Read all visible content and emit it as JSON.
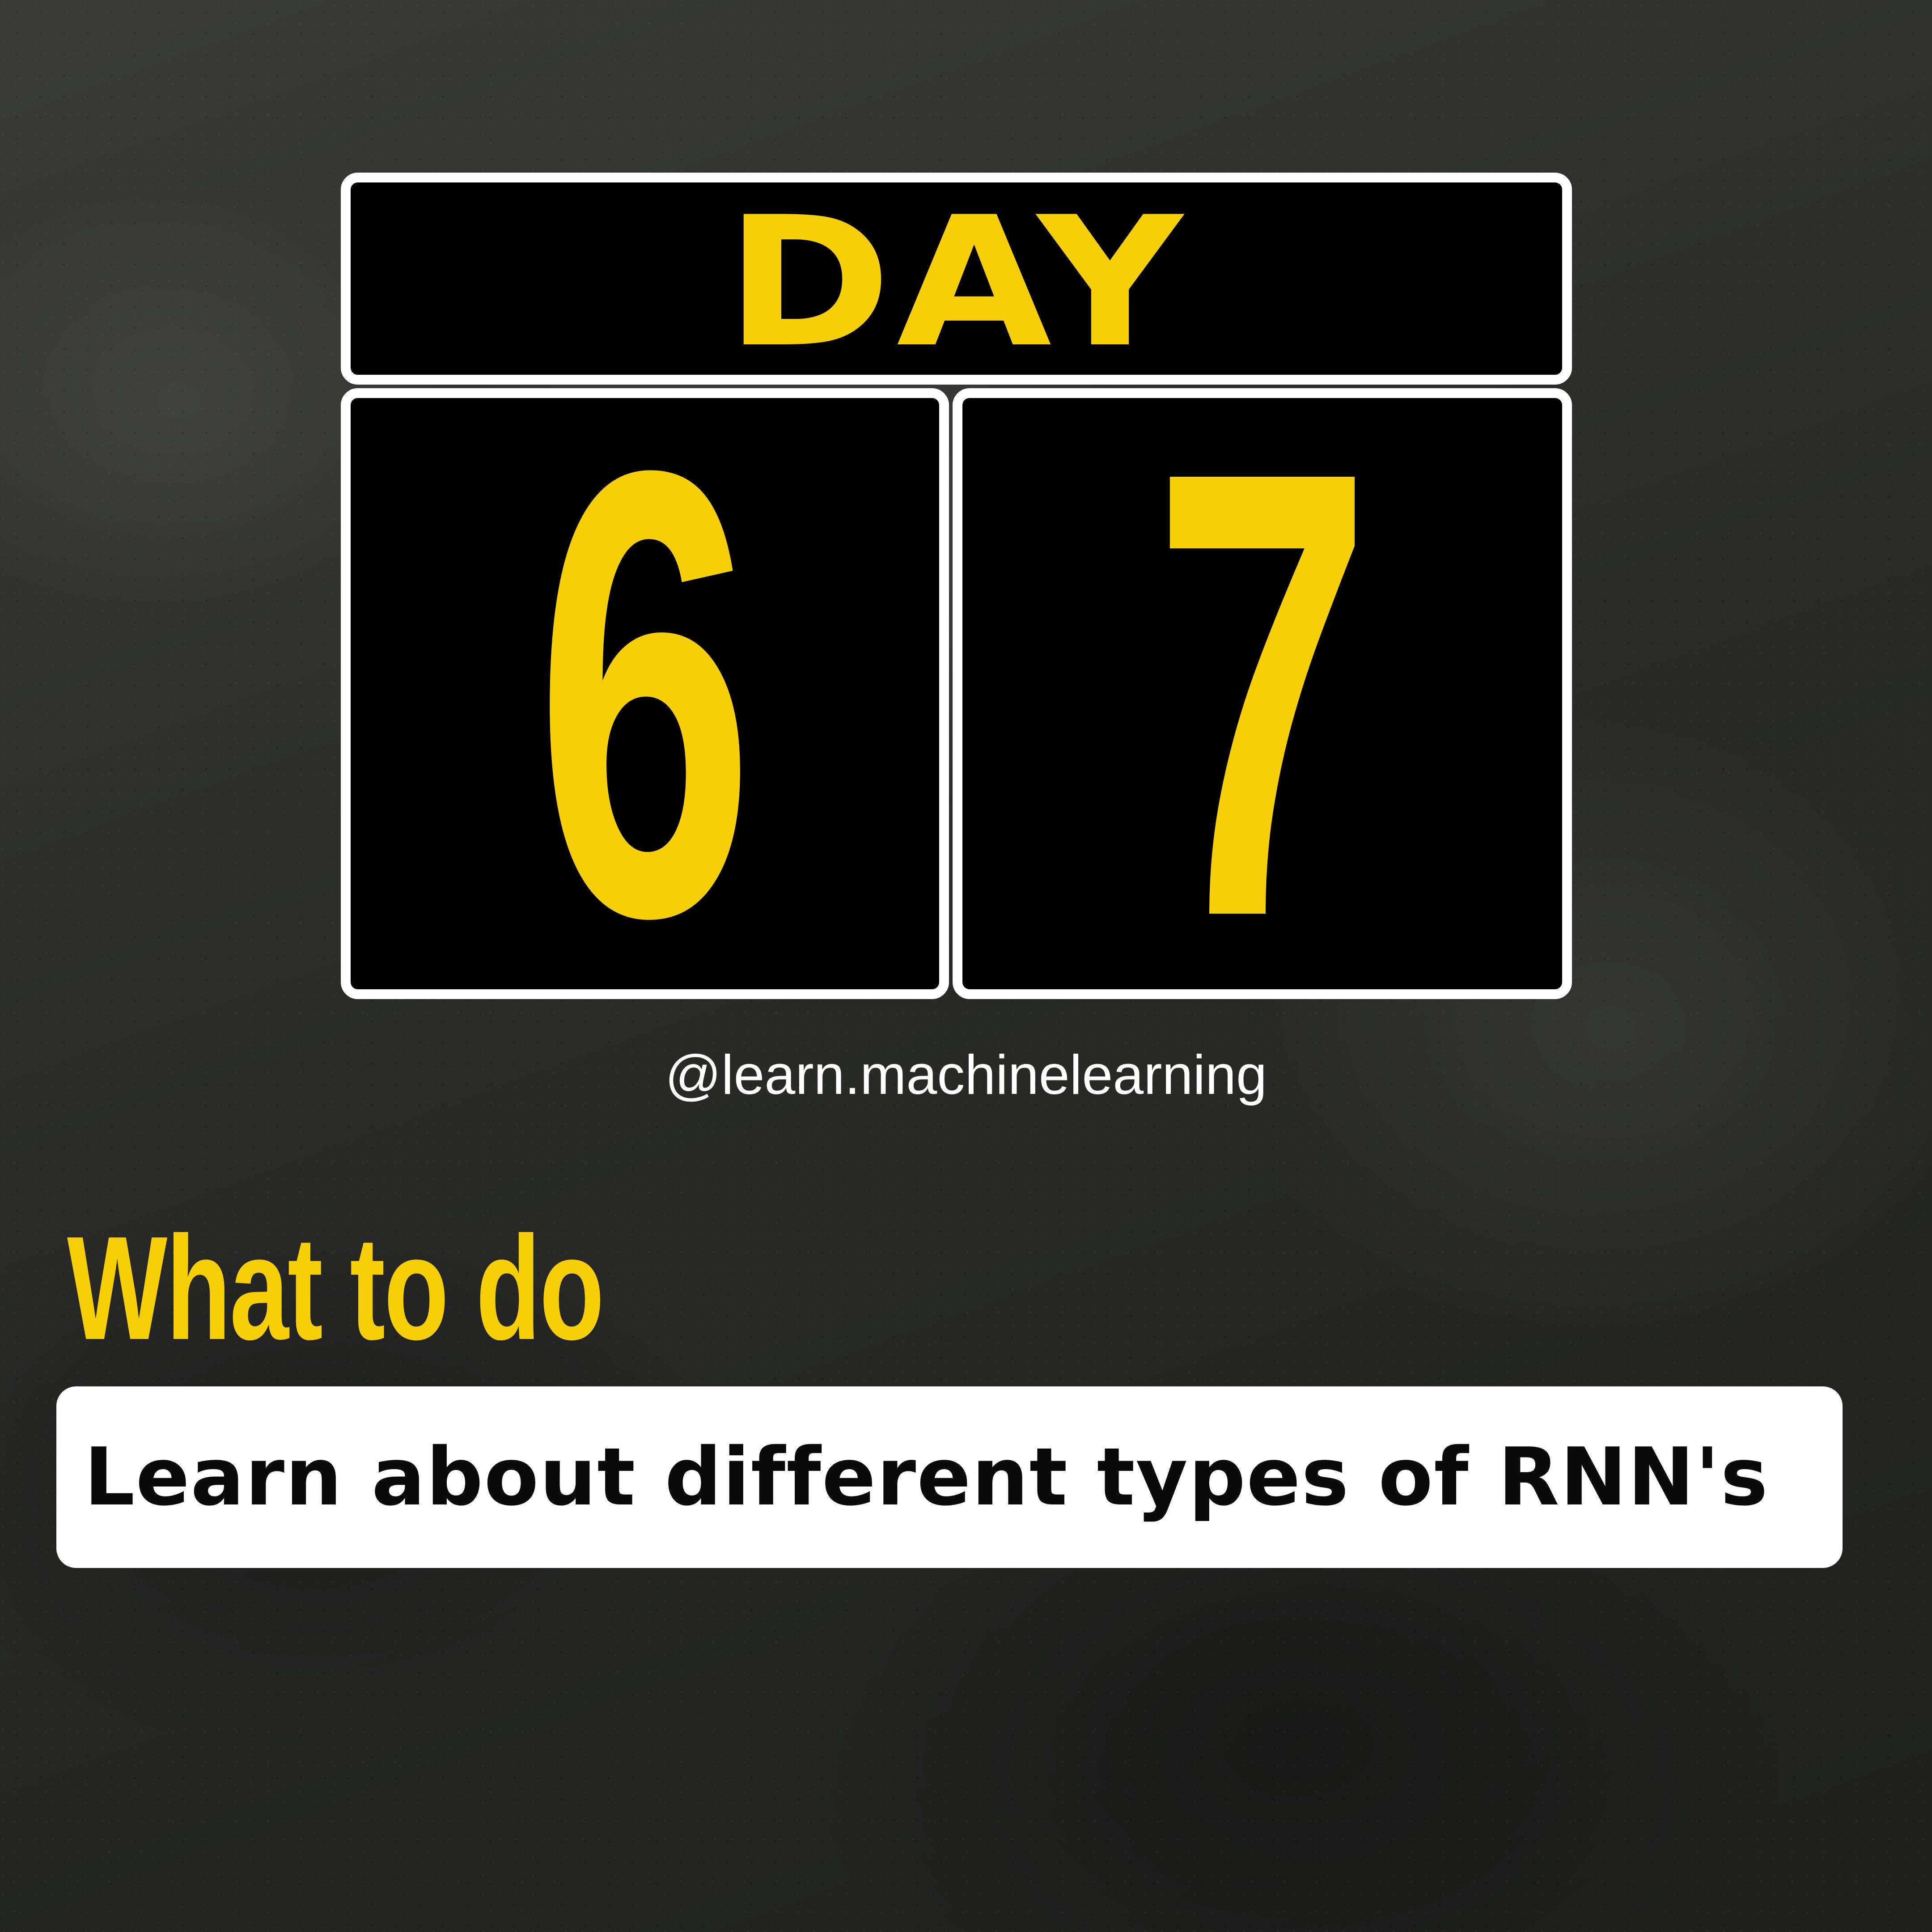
{
  "counter": {
    "label": "DAY",
    "digits": [
      "6",
      "7"
    ]
  },
  "handle": "@learn.machinelearning",
  "section": {
    "heading": "What to do",
    "task": "Learn about different types of RNN's"
  },
  "colors": {
    "accent": "#f7cf08",
    "panel": "#000000",
    "border": "#ffffff",
    "background": "#2b2c2a"
  }
}
